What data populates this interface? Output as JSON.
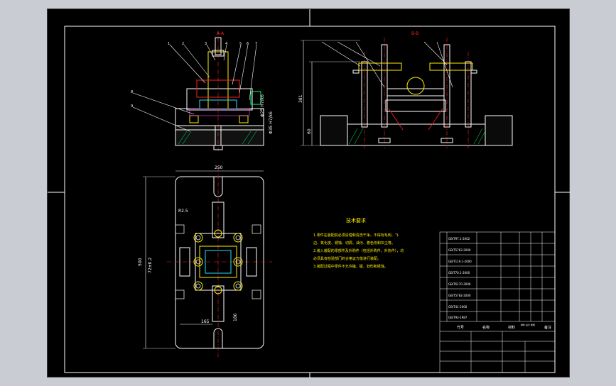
{
  "colors": {
    "background": "#000000",
    "frame": "#ffffff",
    "outline_green": "#00ff66",
    "part_red": "#ff2020",
    "part_yellow": "#ffee00",
    "part_cyan": "#20e0ff",
    "part_blue": "#2050ff",
    "part_magenta": "#ff40ff",
    "outer_bg": "#c9ccd2"
  },
  "section_view_a": {
    "label": "A-A"
  },
  "section_view_b": {
    "label": "B-B"
  },
  "dimensions": {
    "width_250": "250",
    "height_500": "500",
    "height_381": "381",
    "height_60": "60",
    "r2_5": "R2.5",
    "dim_72": "72±0.2",
    "dim_165": "165",
    "dim_180": "180",
    "fit_1": "Φ25 H7/k6",
    "fit_2": "Φ35 H7/k6"
  },
  "tech_requirements": {
    "title": "技术要求",
    "lines": [
      "1.零件在装配前必须清理和清洗干净，不得有毛刺、飞",
      "边、氧化皮、锈蚀、切屑、油污、着色剂和灰尘等。",
      "2.装入装配的零部件及外购件（包括外购件、外协件），均",
      "必须具有检验部门的合格证方能进行装配。",
      "3.装配过程中零件不允许磕、碰、划伤和锈蚀。"
    ]
  },
  "parts_list": {
    "rows": [
      "GB/T97.1-2002",
      "GB/T5783-2000",
      "GB/T119.1-2000",
      "GB/T70.1-2000",
      "GB/T6170-2000",
      "GB/T5782-2000",
      "GB/T41-2000",
      "GB/T93-1987"
    ],
    "header": {
      "code": "代号",
      "name": "名称",
      "material": "材料",
      "weight": "单件 总计 重量",
      "remark": "备注"
    }
  },
  "part_numbers": [
    "1",
    "2",
    "3",
    "4",
    "5",
    "6",
    "7",
    "8",
    "9"
  ]
}
